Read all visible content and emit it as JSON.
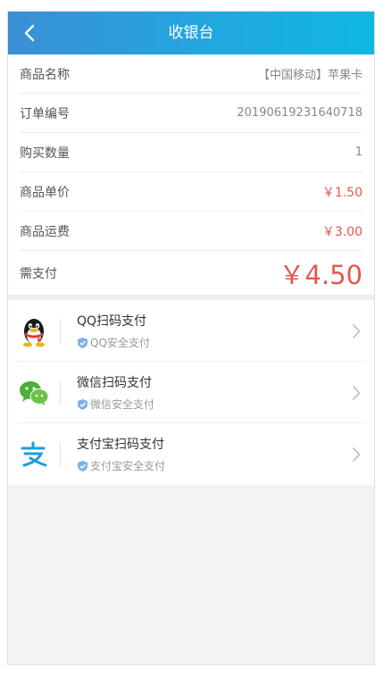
{
  "header": {
    "title": "收银台"
  },
  "order": {
    "rows": [
      {
        "label": "商品名称",
        "value": "【中国移动】苹果卡"
      },
      {
        "label": "订单编号",
        "value": "20190619231640718"
      },
      {
        "label": "购买数量",
        "value": "1"
      },
      {
        "label": "商品单价",
        "value": "￥1.50"
      },
      {
        "label": "商品运费",
        "value": "￥3.00"
      }
    ],
    "total": {
      "label": "需支付",
      "value": "￥4.50"
    }
  },
  "payments": [
    {
      "name": "QQ扫码支付",
      "sub": "QQ安全支付",
      "icon": "qq-icon"
    },
    {
      "name": "微信扫码支付",
      "sub": "微信安全支付",
      "icon": "wechat-icon"
    },
    {
      "name": "支付宝扫码支付",
      "sub": "支付宝安全支付",
      "icon": "alipay-icon"
    }
  ],
  "colors": {
    "header_start": "#3a8fd6",
    "header_end": "#0fb8e0",
    "price": "#e05a4d"
  }
}
